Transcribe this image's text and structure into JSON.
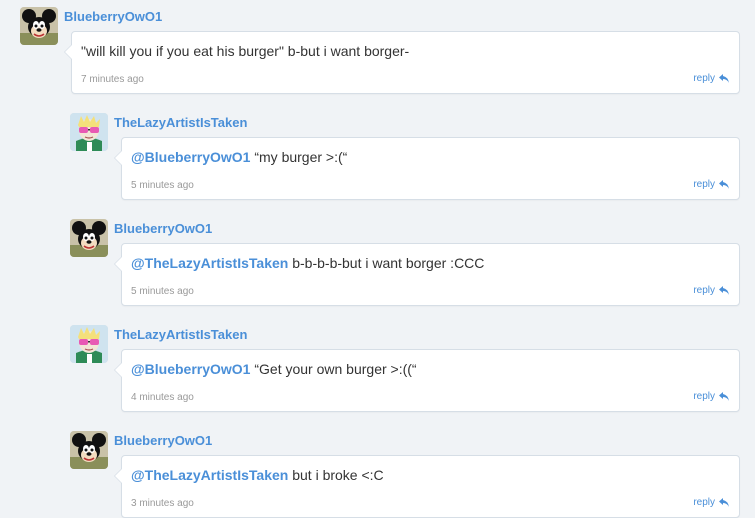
{
  "comments": [
    {
      "username": "BlueberryOwO1",
      "mention": "",
      "text": "\"will kill you if you eat his burger\" b-but i want borger-",
      "time": "7 minutes ago",
      "reply_label": "reply",
      "avatar": "yakko-avatar"
    },
    {
      "username": "TheLazyArtistIsTaken",
      "mention": "@BlueberryOwO1",
      "text": " “my burger >:(“",
      "time": "5 minutes ago",
      "reply_label": "reply",
      "avatar": "lazy-artist-avatar"
    },
    {
      "username": "BlueberryOwO1",
      "mention": "@TheLazyArtistIsTaken",
      "text": " b-b-b-b-but i want borger :CCC",
      "time": "5 minutes ago",
      "reply_label": "reply",
      "avatar": "yakko-avatar"
    },
    {
      "username": "TheLazyArtistIsTaken",
      "mention": "@BlueberryOwO1",
      "text": " “Get your own burger >:((“",
      "time": "4 minutes ago",
      "reply_label": "reply",
      "avatar": "lazy-artist-avatar"
    },
    {
      "username": "BlueberryOwO1",
      "mention": "@TheLazyArtistIsTaken",
      "text": " but i broke <:C",
      "time": "3 minutes ago",
      "reply_label": "reply",
      "avatar": "yakko-avatar"
    }
  ],
  "colors": {
    "link": "#4a8fd8",
    "background": "#f0f3f6"
  }
}
